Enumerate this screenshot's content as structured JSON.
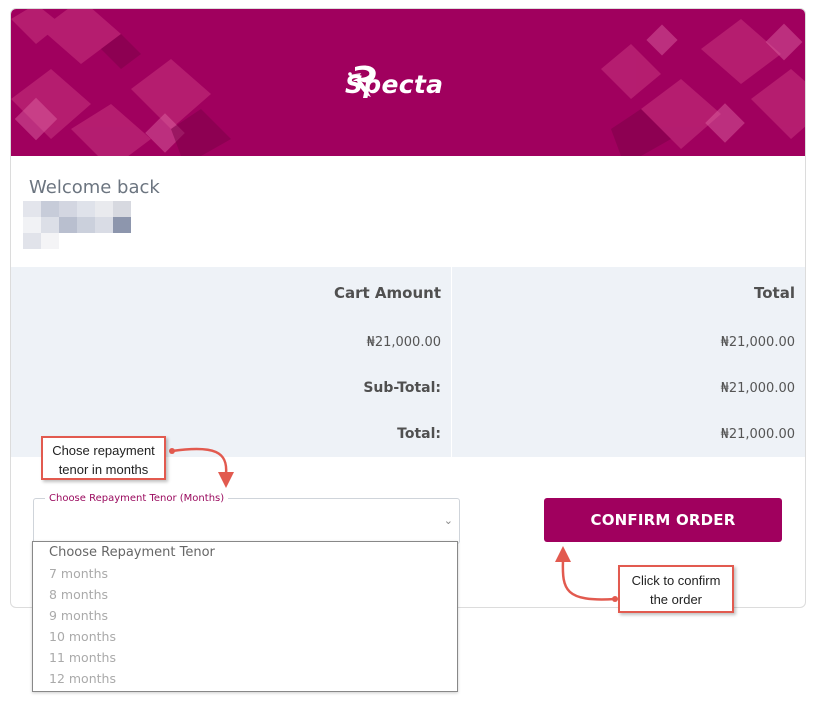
{
  "brand": {
    "name": "Specta",
    "primary_color": "#a0005e",
    "logo_icon": "specta-logo-icon"
  },
  "greeting": {
    "welcome": "Welcome back"
  },
  "cart": {
    "headers": {
      "cart_amount": "Cart Amount",
      "total": "Total"
    },
    "rows": [
      {
        "label": "₦21,000.00",
        "value": "₦21,000.00"
      },
      {
        "label": "Sub-Total:",
        "value": "₦21,000.00"
      },
      {
        "label": "Total:",
        "value": "₦21,000.00"
      }
    ]
  },
  "tenor": {
    "legend": "Choose Repayment Tenor (Months)",
    "options": [
      "Choose Repayment Tenor",
      "7 months",
      "8 months",
      "9 months",
      "10 months",
      "11 months",
      "12 months"
    ]
  },
  "actions": {
    "confirm_label": "CONFIRM ORDER"
  },
  "annotations": {
    "tenor_note": "Chose repayment tenor in months",
    "confirm_note": "Click to confirm the order"
  }
}
